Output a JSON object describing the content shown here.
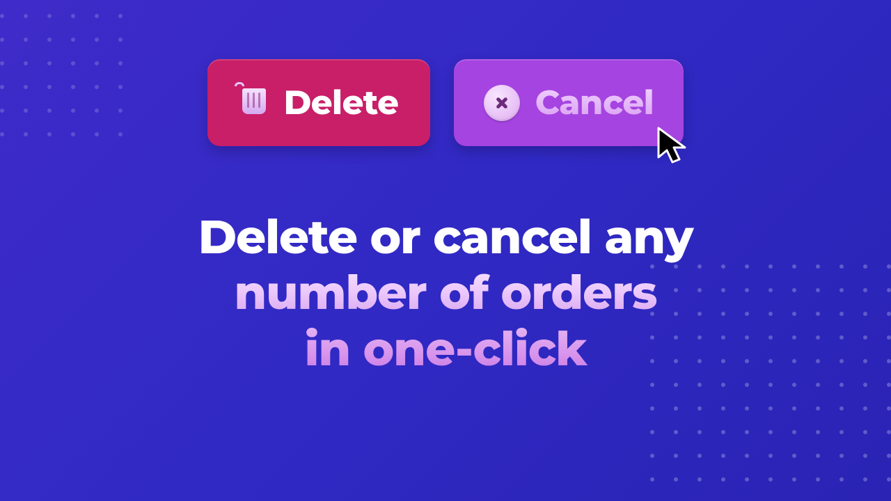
{
  "buttons": {
    "delete_label": "Delete",
    "cancel_label": "Cancel"
  },
  "headline": {
    "line1": "Delete or cancel any",
    "line2": "number of orders",
    "line3": "in one-click"
  }
}
